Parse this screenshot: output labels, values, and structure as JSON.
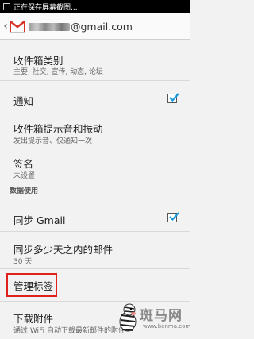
{
  "status_bar": {
    "text": "正在保存屏幕截图..."
  },
  "action_bar": {
    "account_suffix": "@gmail.com"
  },
  "settings": {
    "inbox_category": {
      "title": "收件箱类别",
      "subtitle": "主要, 社交, 宣传, 动态, 论坛"
    },
    "notifications": {
      "title": "通知",
      "checked": true
    },
    "inbox_sound": {
      "title": "收件箱提示音和振动",
      "subtitle": "发出提示音、仅通知一次"
    },
    "signature": {
      "title": "签名",
      "subtitle": "未设置"
    },
    "data_usage_section": "数据使用",
    "sync_gmail": {
      "title": "同步 Gmail",
      "checked": true
    },
    "sync_days": {
      "title": "同步多少天之内的邮件",
      "subtitle": "30 天"
    },
    "manage_labels": {
      "title": "管理标签"
    },
    "download_attachments": {
      "title": "下载附件",
      "subtitle": "通过 WiFi 自动下载最新邮件的附件"
    }
  },
  "watermark": {
    "logo": "斑马网",
    "url": "www.banma.com"
  }
}
